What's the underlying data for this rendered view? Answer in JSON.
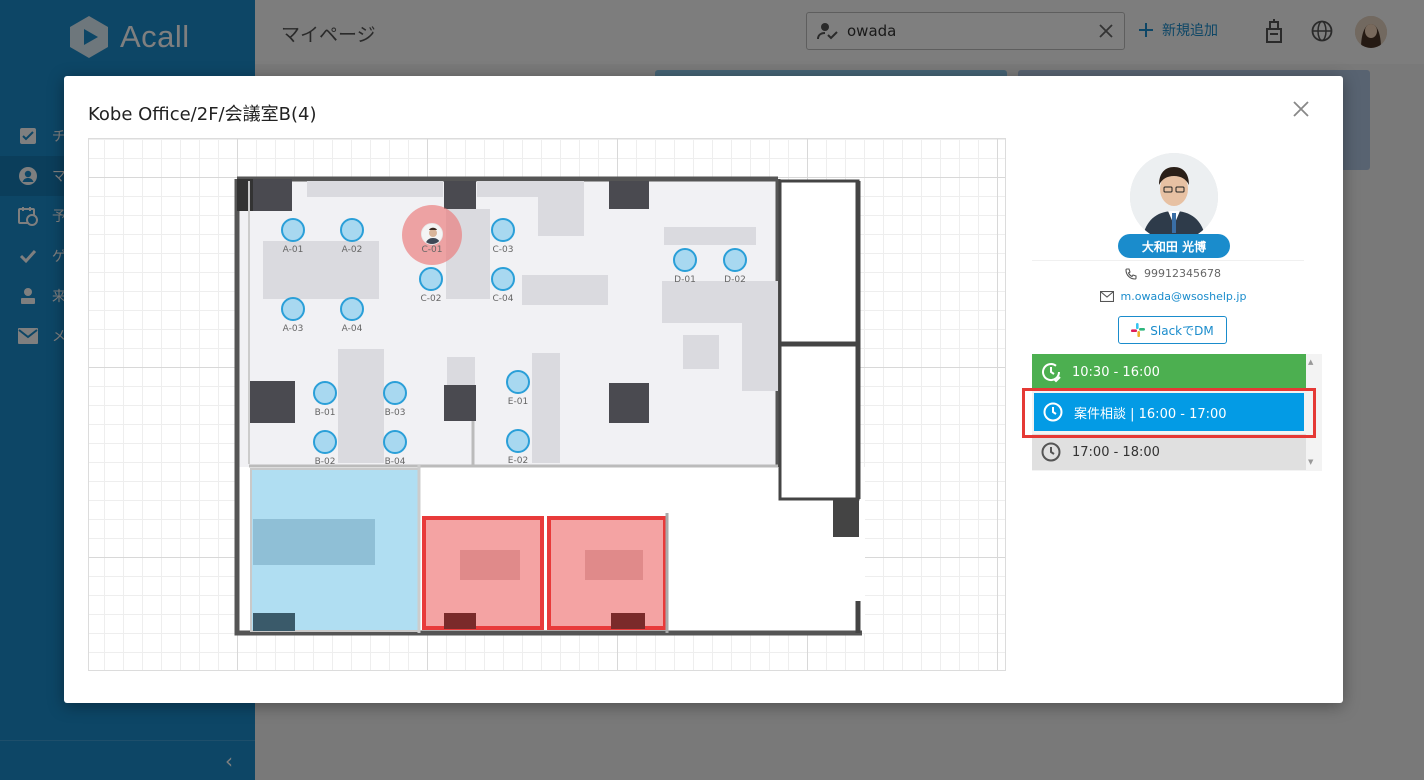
{
  "app": {
    "logo_text": "Acall",
    "page_title": "マイページ",
    "nav_items": [
      {
        "label": "チ",
        "icon": "check-square-icon"
      },
      {
        "label": "マ",
        "icon": "user-circle-icon"
      },
      {
        "label": "予",
        "icon": "calendar-clock-icon"
      },
      {
        "label": "ゲ",
        "icon": "checkmark-icon"
      },
      {
        "label": "来",
        "icon": "visitor-icon"
      },
      {
        "label": "メ",
        "icon": "mail-icon"
      }
    ],
    "collapse_icon": "chevron-left-icon",
    "search": {
      "value": "owada"
    },
    "add_label": "新規追加",
    "accent": "#1a8ccc"
  },
  "modal": {
    "title": "Kobe Office/2F/会議室B(4)",
    "close_icon": "close-icon",
    "floorplan": {
      "seats": [
        {
          "id": "A-01"
        },
        {
          "id": "A-02"
        },
        {
          "id": "A-03"
        },
        {
          "id": "A-04"
        },
        {
          "id": "B-01"
        },
        {
          "id": "B-02"
        },
        {
          "id": "B-03"
        },
        {
          "id": "B-04"
        },
        {
          "id": "C-01",
          "occupied": true
        },
        {
          "id": "C-02"
        },
        {
          "id": "C-03"
        },
        {
          "id": "C-04"
        },
        {
          "id": "D-01"
        },
        {
          "id": "D-02"
        },
        {
          "id": "E-01"
        },
        {
          "id": "E-02"
        }
      ],
      "rooms": [
        {
          "status": "selected",
          "color": "#b0def2"
        },
        {
          "status": "reserved",
          "color": "#f4a3a3"
        },
        {
          "status": "reserved",
          "color": "#f4a3a3"
        }
      ]
    },
    "profile": {
      "name": "大和田 光博",
      "phone": "99912345678",
      "email": "m.owada@wsoshelp.jp",
      "slack_label": "SlackでDM"
    },
    "schedule": [
      {
        "time": "10:30 - 16:00",
        "color": "#4caf50",
        "icon": "clock-check-icon"
      },
      {
        "time": "案件相談 | 16:00 - 17:00",
        "color": "#039be5",
        "icon": "clock-icon",
        "highlighted": true
      },
      {
        "time": "17:00 - 18:00",
        "color": "#e0e0e0",
        "icon": "clock-icon"
      }
    ]
  }
}
